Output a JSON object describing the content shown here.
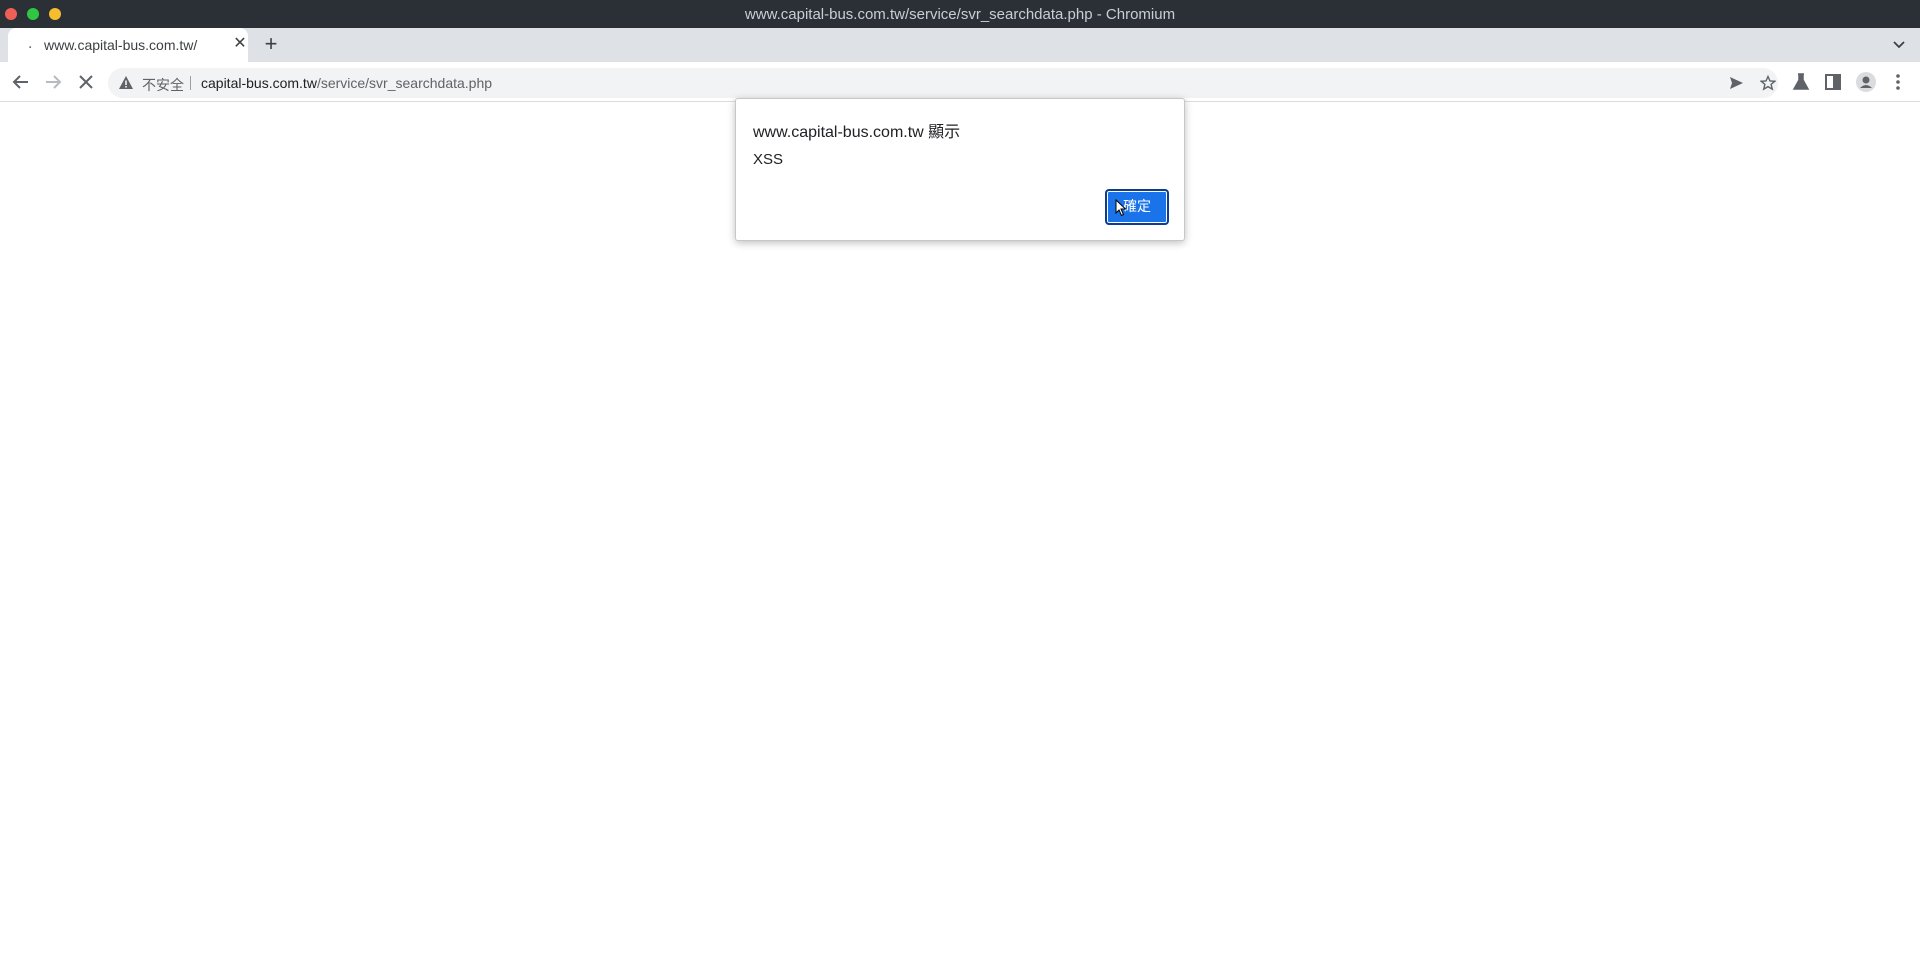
{
  "window": {
    "title": "www.capital-bus.com.tw/service/svr_searchdata.php - Chromium"
  },
  "tabs": [
    {
      "title": "www.capital-bus.com.tw/",
      "loading": true,
      "active": true
    }
  ],
  "toolbar": {
    "security_label": "不安全",
    "url_host": "capital-bus.com.tw",
    "url_path": "/service/svr_searchdata.php"
  },
  "dialog": {
    "title": "www.capital-bus.com.tw 顯示",
    "message": "XSS",
    "ok_label": "確定"
  },
  "colors": {
    "accent": "#1a73e8",
    "titlebar": "#2b2f36",
    "tabstrip": "#dee1e6"
  },
  "icons": [
    "back-arrow-icon",
    "forward-arrow-icon",
    "stop-icon",
    "warning-icon",
    "send-icon",
    "star-icon",
    "labs-icon",
    "side-panel-icon",
    "profile-icon",
    "menu-icon",
    "close-icon",
    "plus-icon",
    "chevron-down-icon"
  ]
}
